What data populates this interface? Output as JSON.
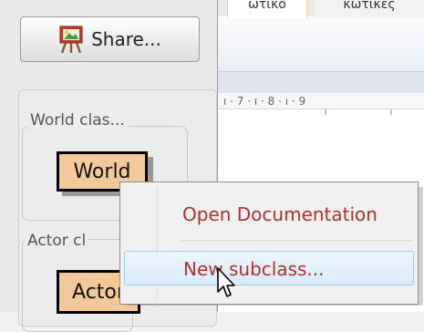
{
  "share_button": {
    "label": "Share..."
  },
  "class_groups": {
    "world": {
      "label": "World clas...",
      "class_name": "World"
    },
    "actor": {
      "label": "Actor cl",
      "class_name": "Actor"
    }
  },
  "editor": {
    "tabs": [
      "ωτικό",
      "κωτικές"
    ],
    "ruler_text": "ı · 7 · ı · 8 · ı · 9"
  },
  "context_menu": {
    "items": [
      {
        "label": "Open Documentation"
      },
      {
        "label": "New subclass..."
      }
    ]
  },
  "colors": {
    "class_box": "#f4c99a",
    "menu_text": "#b3302c",
    "highlight_border": "#9ecbf2"
  }
}
